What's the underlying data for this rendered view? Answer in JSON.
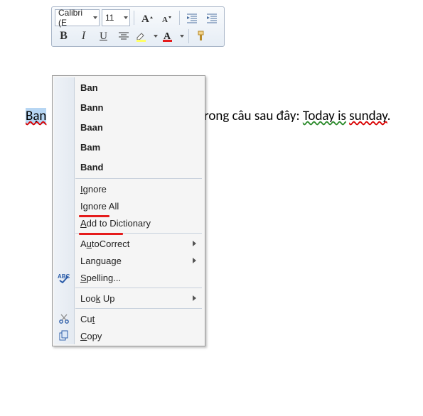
{
  "toolbar": {
    "font_name": "Calibri (E",
    "font_size": "11"
  },
  "doc": {
    "selected_word": "Bạn",
    "visible_middle": "rong câu sau đây: ",
    "word_today": "Today is",
    "word_sunday": "sunday",
    "period": "."
  },
  "menu": {
    "suggestions": [
      "Ban",
      "Bann",
      "Baan",
      "Bam",
      "Band"
    ],
    "ignore": "Ignore",
    "ignore_all": "Ignore All",
    "add_dict": "Add to Dictionary",
    "autocorrect": "AutoCorrect",
    "language": "Language",
    "spelling": "Spelling...",
    "lookup": "Look Up",
    "cut": "Cut",
    "copy": "Copy"
  }
}
